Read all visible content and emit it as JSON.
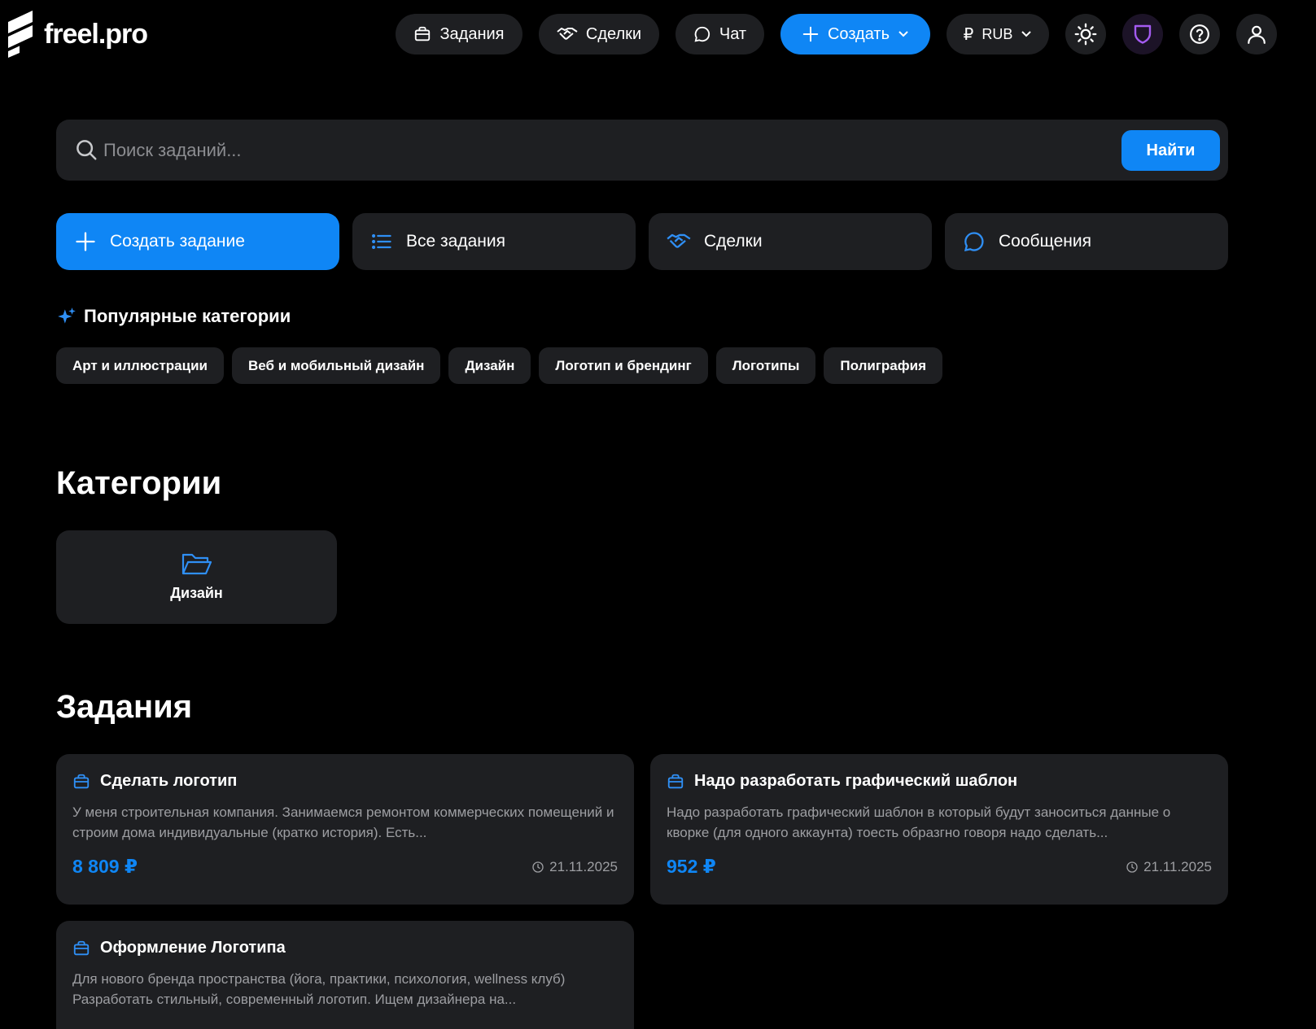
{
  "brand": {
    "name": "freel.pro"
  },
  "nav": {
    "tasks": "Задания",
    "deals": "Сделки",
    "chat": "Чат",
    "create": "Создать",
    "currency": "RUB"
  },
  "search": {
    "placeholder": "Поиск заданий...",
    "button": "Найти"
  },
  "quick_actions": {
    "create_task": "Создать задание",
    "all_tasks": "Все задания",
    "deals": "Сделки",
    "messages": "Сообщения"
  },
  "popular": {
    "title": "Популярные категории",
    "chips": [
      "Арт и иллюстрации",
      "Веб и мобильный дизайн",
      "Дизайн",
      "Логотип и брендинг",
      "Логотипы",
      "Полиграфия"
    ]
  },
  "categories": {
    "title": "Категории",
    "items": [
      {
        "label": "Дизайн",
        "icon": "folder-open-icon"
      }
    ]
  },
  "tasks": {
    "title": "Задания",
    "items": [
      {
        "title": "Сделать логотип",
        "description": "У меня строительная компания. Занимаемся ремонтом коммерческих помещений и строим дома индивидуальные (кратко история). Есть...",
        "price": "8 809 ₽",
        "date": "21.11.2025"
      },
      {
        "title": "Надо разработать графический шаблон",
        "description": "Надо разработать графический шаблон в который будут заноситься данные о кворке (для одного аккаунта) тоесть образгно говоря надо сделать...",
        "price": "952 ₽",
        "date": "21.11.2025"
      },
      {
        "title": "Оформление Логотипа",
        "description": "Для нового бренда пространства (йога, практики, психология, wellness клуб) Разработать стильный, современный логотип. Ищем дизайнера на...",
        "price": "",
        "date": ""
      }
    ]
  },
  "colors": {
    "accent": "#0f86f5",
    "surface": "#1e1f22",
    "background": "#000000",
    "muted": "#9d9ea2",
    "shield": "#a45bf0"
  }
}
